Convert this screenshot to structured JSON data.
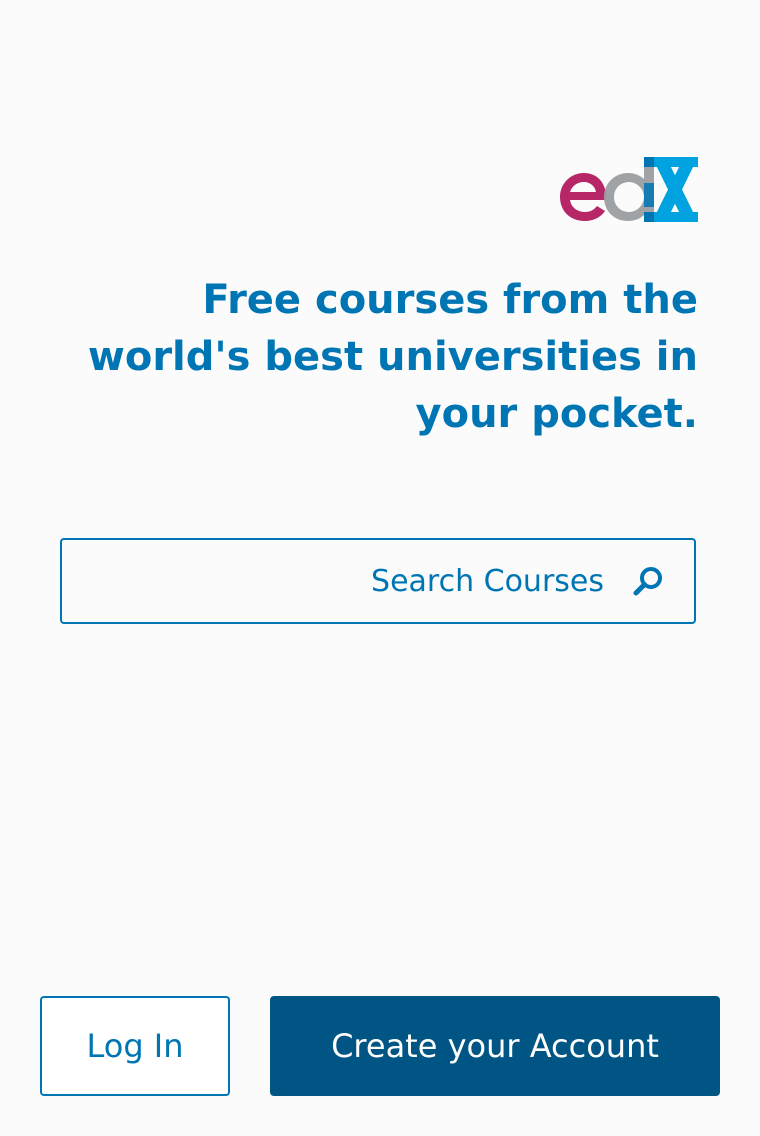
{
  "logo": {
    "name": "edX",
    "colors": {
      "e": "#b72667",
      "d": "#9b9ea1",
      "x": "#00a3e0",
      "x_dark": "#0075b4"
    }
  },
  "headline": "Free courses from the world's best universities in your pocket.",
  "search": {
    "placeholder": "Search Courses",
    "icon": "search-icon"
  },
  "actions": {
    "login_label": "Log In",
    "create_account_label": "Create your Account"
  },
  "colors": {
    "primary": "#0075b4",
    "primary_dark": "#005585",
    "background": "#fbfbfb"
  }
}
